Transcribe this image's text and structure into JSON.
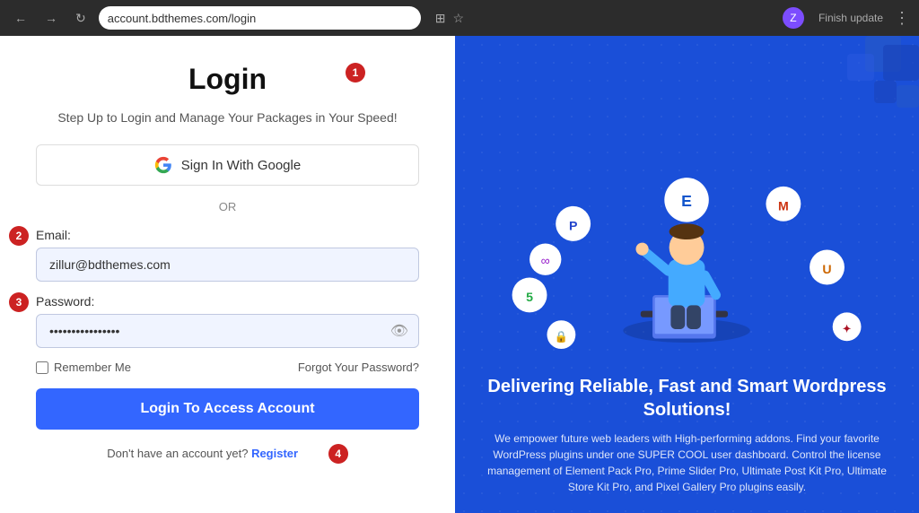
{
  "browser": {
    "url": "account.bdthemes.com/login",
    "finish_update": "Finish update",
    "profile_letter": "Z"
  },
  "left": {
    "title": "Login",
    "subtitle": "Step Up to Login and Manage Your Packages in Your Speed!",
    "google_btn": "Sign In With Google",
    "or_text": "OR",
    "email_label": "Email:",
    "email_value": "zillur@bdthemes.com",
    "password_label": "Password:",
    "password_value": "••••••••••••••••",
    "remember_label": "Remember Me",
    "forgot_label": "Forgot Your Password?",
    "login_btn": "Login To Access Account",
    "register_text": "Don't have an account yet?",
    "register_link": "Register"
  },
  "right": {
    "heading": "Delivering Reliable, Fast and Smart Wordpress Solutions!",
    "subtext": "We empower future web leaders with High-performing addons. Find your favorite WordPress plugins under one SUPER COOL user dashboard. Control the license management of Element Pack Pro, Prime Slider Pro, Ultimate Post Kit Pro, Ultimate Store Kit Pro, and Pixel Gallery Pro plugins easily."
  },
  "annotations": {
    "one": "1",
    "two": "2",
    "three": "3",
    "four": "4"
  }
}
